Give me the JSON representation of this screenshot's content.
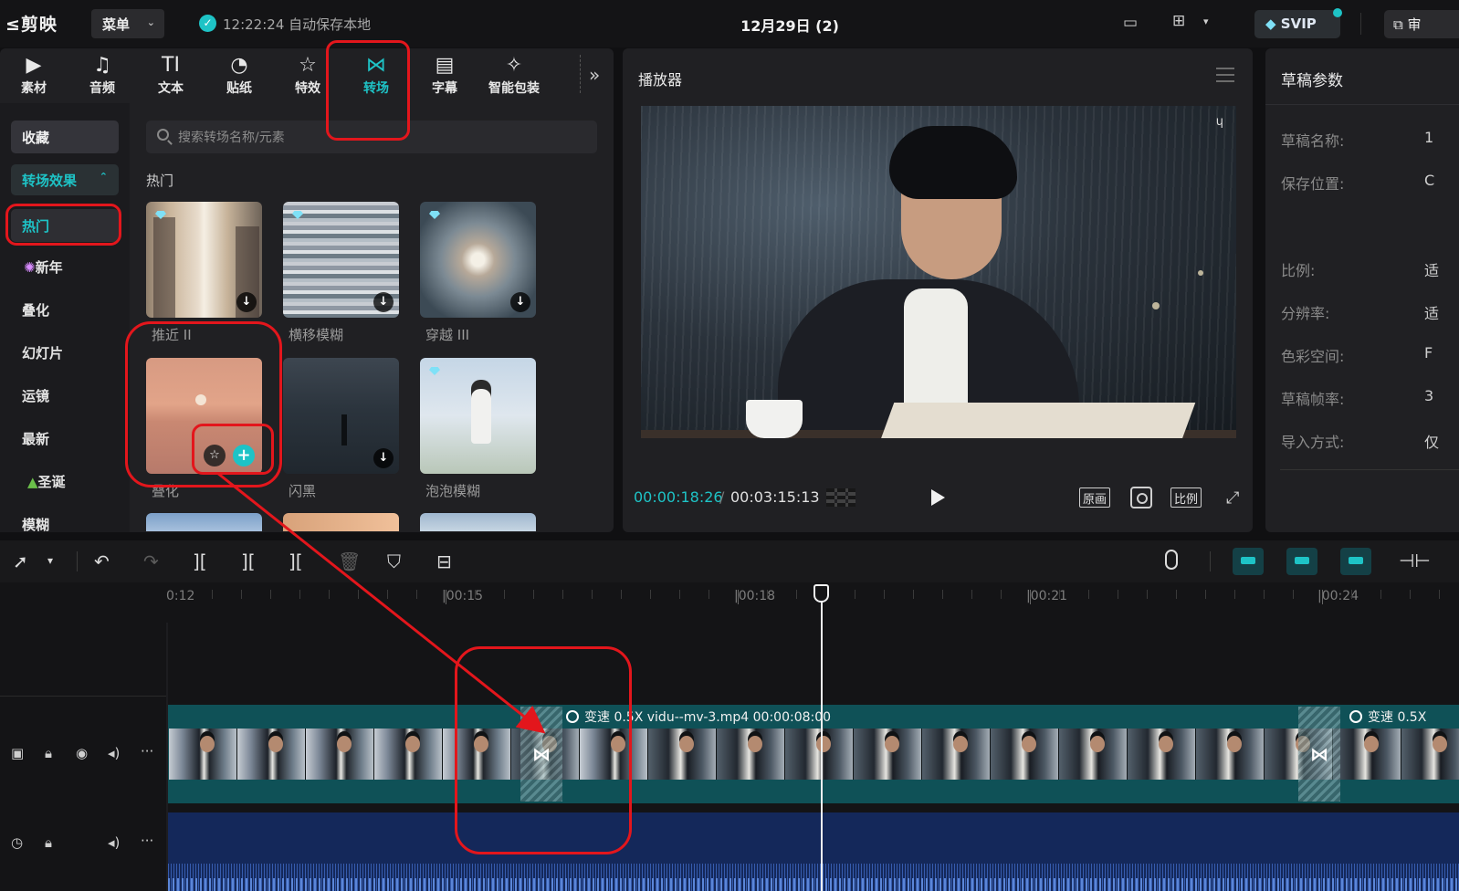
{
  "titlebar": {
    "app_name": "剪映",
    "menu_label": "菜单",
    "autosave_text": "12:22:24 自动保存本地",
    "project_title": "12月29日 (2)",
    "svip_label": "SVIP",
    "export_label": "审"
  },
  "tool_tabs": [
    {
      "label": "素材",
      "icon": "media-icon"
    },
    {
      "label": "音频",
      "icon": "audio-icon"
    },
    {
      "label": "文本",
      "icon": "text-icon",
      "glyph": "TI"
    },
    {
      "label": "贴纸",
      "icon": "sticker-icon"
    },
    {
      "label": "特效",
      "icon": "effects-icon"
    },
    {
      "label": "转场",
      "icon": "transition-icon",
      "active": true
    },
    {
      "label": "字幕",
      "icon": "subtitle-icon"
    },
    {
      "label": "智能包装",
      "icon": "smart-package-icon"
    }
  ],
  "categories": {
    "favorites": "收藏",
    "transitions": "转场效果",
    "hot": "热门",
    "new_year": "新年",
    "dissolve": "叠化",
    "slideshow": "幻灯片",
    "camera": "运镜",
    "latest": "最新",
    "christmas": "圣诞",
    "blur": "模糊"
  },
  "search": {
    "placeholder": "搜索转场名称/元素"
  },
  "section_title": "热门",
  "effects": [
    {
      "name": "推近 II"
    },
    {
      "name": "横移模糊"
    },
    {
      "name": "穿越 III"
    },
    {
      "name": "叠化"
    },
    {
      "name": "闪黑"
    },
    {
      "name": "泡泡模糊"
    }
  ],
  "player": {
    "title": "播放器",
    "current_time": "00:00:18:26",
    "separator": "/",
    "total_time": "00:03:15:13",
    "btn_original": "原画",
    "btn_ratio": "比例"
  },
  "draft_params": {
    "title": "草稿参数",
    "labels": [
      "草稿名称:",
      "保存位置:",
      "比例:",
      "分辨率:",
      "色彩空间:",
      "草稿帧率:",
      "导入方式:"
    ],
    "values_visible": [
      "1",
      "C",
      "适",
      "适",
      "F",
      "3",
      "仅"
    ]
  },
  "timeline": {
    "ruler_labels": [
      "0:12",
      "|00:15",
      "|00:18",
      "|00:21",
      "|00:24"
    ],
    "clip_header": "变速 0.5X   vidu--mv-3.mp4   00:00:08:00",
    "clip_header_next": "变速 0.5X"
  },
  "colors": {
    "accent": "#1ec3c6",
    "annotation": "#e3161c",
    "video_track": "#0f5157",
    "audio_track": "#14285a"
  }
}
